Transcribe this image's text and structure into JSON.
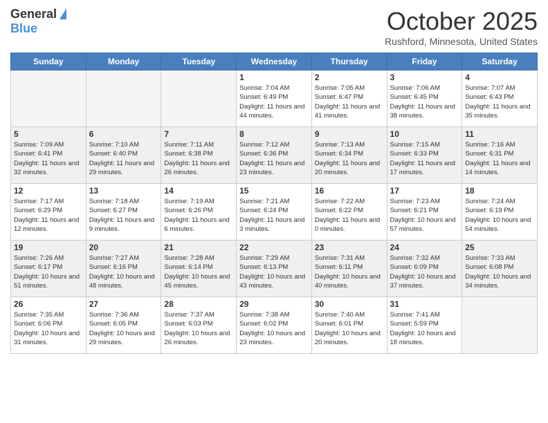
{
  "logo": {
    "general": "General",
    "blue": "Blue"
  },
  "title": "October 2025",
  "location": "Rushford, Minnesota, United States",
  "days_of_week": [
    "Sunday",
    "Monday",
    "Tuesday",
    "Wednesday",
    "Thursday",
    "Friday",
    "Saturday"
  ],
  "weeks": [
    [
      {
        "day": "",
        "sunrise": "",
        "sunset": "",
        "daylight": "",
        "empty": true
      },
      {
        "day": "",
        "sunrise": "",
        "sunset": "",
        "daylight": "",
        "empty": true
      },
      {
        "day": "",
        "sunrise": "",
        "sunset": "",
        "daylight": "",
        "empty": true
      },
      {
        "day": "1",
        "sunrise": "Sunrise: 7:04 AM",
        "sunset": "Sunset: 6:49 PM",
        "daylight": "Daylight: 11 hours and 44 minutes."
      },
      {
        "day": "2",
        "sunrise": "Sunrise: 7:05 AM",
        "sunset": "Sunset: 6:47 PM",
        "daylight": "Daylight: 11 hours and 41 minutes."
      },
      {
        "day": "3",
        "sunrise": "Sunrise: 7:06 AM",
        "sunset": "Sunset: 6:45 PM",
        "daylight": "Daylight: 11 hours and 38 minutes."
      },
      {
        "day": "4",
        "sunrise": "Sunrise: 7:07 AM",
        "sunset": "Sunset: 6:43 PM",
        "daylight": "Daylight: 11 hours and 35 minutes."
      }
    ],
    [
      {
        "day": "5",
        "sunrise": "Sunrise: 7:09 AM",
        "sunset": "Sunset: 6:41 PM",
        "daylight": "Daylight: 11 hours and 32 minutes."
      },
      {
        "day": "6",
        "sunrise": "Sunrise: 7:10 AM",
        "sunset": "Sunset: 6:40 PM",
        "daylight": "Daylight: 11 hours and 29 minutes."
      },
      {
        "day": "7",
        "sunrise": "Sunrise: 7:11 AM",
        "sunset": "Sunset: 6:38 PM",
        "daylight": "Daylight: 11 hours and 26 minutes."
      },
      {
        "day": "8",
        "sunrise": "Sunrise: 7:12 AM",
        "sunset": "Sunset: 6:36 PM",
        "daylight": "Daylight: 11 hours and 23 minutes."
      },
      {
        "day": "9",
        "sunrise": "Sunrise: 7:13 AM",
        "sunset": "Sunset: 6:34 PM",
        "daylight": "Daylight: 11 hours and 20 minutes."
      },
      {
        "day": "10",
        "sunrise": "Sunrise: 7:15 AM",
        "sunset": "Sunset: 6:33 PM",
        "daylight": "Daylight: 11 hours and 17 minutes."
      },
      {
        "day": "11",
        "sunrise": "Sunrise: 7:16 AM",
        "sunset": "Sunset: 6:31 PM",
        "daylight": "Daylight: 11 hours and 14 minutes."
      }
    ],
    [
      {
        "day": "12",
        "sunrise": "Sunrise: 7:17 AM",
        "sunset": "Sunset: 6:29 PM",
        "daylight": "Daylight: 11 hours and 12 minutes."
      },
      {
        "day": "13",
        "sunrise": "Sunrise: 7:18 AM",
        "sunset": "Sunset: 6:27 PM",
        "daylight": "Daylight: 11 hours and 9 minutes."
      },
      {
        "day": "14",
        "sunrise": "Sunrise: 7:19 AM",
        "sunset": "Sunset: 6:26 PM",
        "daylight": "Daylight: 11 hours and 6 minutes."
      },
      {
        "day": "15",
        "sunrise": "Sunrise: 7:21 AM",
        "sunset": "Sunset: 6:24 PM",
        "daylight": "Daylight: 11 hours and 3 minutes."
      },
      {
        "day": "16",
        "sunrise": "Sunrise: 7:22 AM",
        "sunset": "Sunset: 6:22 PM",
        "daylight": "Daylight: 11 hours and 0 minutes."
      },
      {
        "day": "17",
        "sunrise": "Sunrise: 7:23 AM",
        "sunset": "Sunset: 6:21 PM",
        "daylight": "Daylight: 10 hours and 57 minutes."
      },
      {
        "day": "18",
        "sunrise": "Sunrise: 7:24 AM",
        "sunset": "Sunset: 6:19 PM",
        "daylight": "Daylight: 10 hours and 54 minutes."
      }
    ],
    [
      {
        "day": "19",
        "sunrise": "Sunrise: 7:26 AM",
        "sunset": "Sunset: 6:17 PM",
        "daylight": "Daylight: 10 hours and 51 minutes."
      },
      {
        "day": "20",
        "sunrise": "Sunrise: 7:27 AM",
        "sunset": "Sunset: 6:16 PM",
        "daylight": "Daylight: 10 hours and 48 minutes."
      },
      {
        "day": "21",
        "sunrise": "Sunrise: 7:28 AM",
        "sunset": "Sunset: 6:14 PM",
        "daylight": "Daylight: 10 hours and 45 minutes."
      },
      {
        "day": "22",
        "sunrise": "Sunrise: 7:29 AM",
        "sunset": "Sunset: 6:13 PM",
        "daylight": "Daylight: 10 hours and 43 minutes."
      },
      {
        "day": "23",
        "sunrise": "Sunrise: 7:31 AM",
        "sunset": "Sunset: 6:11 PM",
        "daylight": "Daylight: 10 hours and 40 minutes."
      },
      {
        "day": "24",
        "sunrise": "Sunrise: 7:32 AM",
        "sunset": "Sunset: 6:09 PM",
        "daylight": "Daylight: 10 hours and 37 minutes."
      },
      {
        "day": "25",
        "sunrise": "Sunrise: 7:33 AM",
        "sunset": "Sunset: 6:08 PM",
        "daylight": "Daylight: 10 hours and 34 minutes."
      }
    ],
    [
      {
        "day": "26",
        "sunrise": "Sunrise: 7:35 AM",
        "sunset": "Sunset: 6:06 PM",
        "daylight": "Daylight: 10 hours and 31 minutes."
      },
      {
        "day": "27",
        "sunrise": "Sunrise: 7:36 AM",
        "sunset": "Sunset: 6:05 PM",
        "daylight": "Daylight: 10 hours and 29 minutes."
      },
      {
        "day": "28",
        "sunrise": "Sunrise: 7:37 AM",
        "sunset": "Sunset: 6:03 PM",
        "daylight": "Daylight: 10 hours and 26 minutes."
      },
      {
        "day": "29",
        "sunrise": "Sunrise: 7:38 AM",
        "sunset": "Sunset: 6:02 PM",
        "daylight": "Daylight: 10 hours and 23 minutes."
      },
      {
        "day": "30",
        "sunrise": "Sunrise: 7:40 AM",
        "sunset": "Sunset: 6:01 PM",
        "daylight": "Daylight: 10 hours and 20 minutes."
      },
      {
        "day": "31",
        "sunrise": "Sunrise: 7:41 AM",
        "sunset": "Sunset: 5:59 PM",
        "daylight": "Daylight: 10 hours and 18 minutes."
      },
      {
        "day": "",
        "sunrise": "",
        "sunset": "",
        "daylight": "",
        "empty": true
      }
    ]
  ]
}
